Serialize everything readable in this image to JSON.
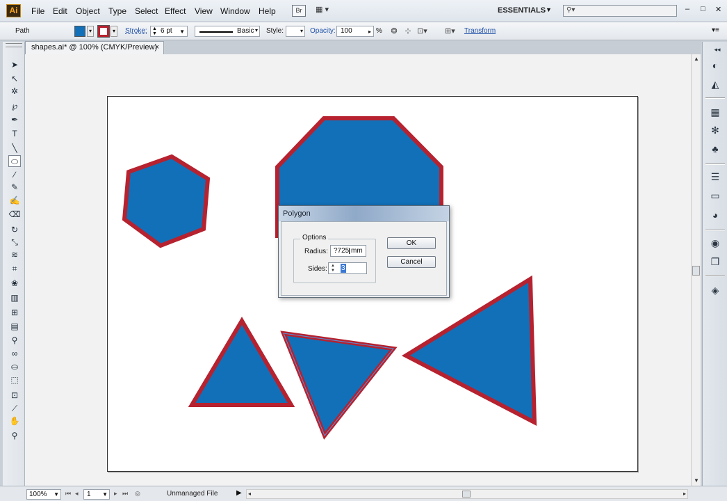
{
  "app": {
    "logo_text": "Ai",
    "menu": [
      "File",
      "Edit",
      "Object",
      "Type",
      "Select",
      "Effect",
      "View",
      "Window",
      "Help"
    ],
    "bridge_label": "Br",
    "workspace": "ESSENTIALS",
    "window_controls": {
      "minimize": "–",
      "restore": "□",
      "close": "✕"
    }
  },
  "control_bar": {
    "selection_type": "Path",
    "stroke_label": "Stroke:",
    "stroke_weight": "6 pt",
    "brush_label": "Basic",
    "style_label": "Style:",
    "opacity_label": "Opacity:",
    "opacity_value": "100",
    "opacity_unit": "%",
    "transform_label": "Transform",
    "colors": {
      "fill": "#1270b8",
      "stroke": "#b6222f"
    }
  },
  "document": {
    "tab_title": "shapes.ai* @ 100% (CMYK/Preview)",
    "tab_close": "×"
  },
  "tools": [
    {
      "name": "selection-tool-icon",
      "glyph": "➤"
    },
    {
      "name": "direct-selection-tool-icon",
      "glyph": "↖"
    },
    {
      "name": "magic-wand-tool-icon",
      "glyph": "✲"
    },
    {
      "name": "lasso-tool-icon",
      "glyph": "℘"
    },
    {
      "name": "pen-tool-icon",
      "glyph": "✒"
    },
    {
      "name": "type-tool-icon",
      "glyph": "T"
    },
    {
      "name": "line-segment-tool-icon",
      "glyph": "╲"
    },
    {
      "name": "shape-tool-icon",
      "glyph": "⬭",
      "active": true
    },
    {
      "name": "paintbrush-tool-icon",
      "glyph": "∕"
    },
    {
      "name": "pencil-tool-icon",
      "glyph": "✎"
    },
    {
      "name": "blob-brush-tool-icon",
      "glyph": "✍"
    },
    {
      "name": "eraser-tool-icon",
      "glyph": "⌫"
    },
    {
      "name": "rotate-tool-icon",
      "glyph": "↻"
    },
    {
      "name": "scale-tool-icon",
      "glyph": "⤡"
    },
    {
      "name": "warp-tool-icon",
      "glyph": "≋"
    },
    {
      "name": "free-transform-tool-icon",
      "glyph": "⌗"
    },
    {
      "name": "symbol-sprayer-tool-icon",
      "glyph": "❀"
    },
    {
      "name": "graph-tool-icon",
      "glyph": "▥"
    },
    {
      "name": "mesh-tool-icon",
      "glyph": "⊞"
    },
    {
      "name": "gradient-tool-icon",
      "glyph": "▤"
    },
    {
      "name": "eyedropper-tool-icon",
      "glyph": "⚲"
    },
    {
      "name": "blend-tool-icon",
      "glyph": "∞"
    },
    {
      "name": "live-paint-bucket-tool-icon",
      "glyph": "⛀"
    },
    {
      "name": "live-paint-selection-tool-icon",
      "glyph": "⬚"
    },
    {
      "name": "artboard-tool-icon",
      "glyph": "⊡"
    },
    {
      "name": "slice-tool-icon",
      "glyph": "⟋"
    },
    {
      "name": "hand-tool-icon",
      "glyph": "✋"
    },
    {
      "name": "zoom-tool-icon",
      "glyph": "⚲"
    }
  ],
  "dock_icons": [
    "color-panel-icon",
    "color-guide-icon",
    "swatches-icon",
    "brushes-icon",
    "symbols-icon",
    "stroke-panel-icon",
    "gradient-panel-icon",
    "transparency-panel-icon",
    "appearance-panel-icon",
    "graphic-styles-icon",
    "layers-panel-icon"
  ],
  "dock_glyphs": [
    "◐",
    "◭",
    "▦",
    "✻",
    "♣",
    "☰",
    "▭",
    "◕",
    "◉",
    "❐",
    "◈"
  ],
  "dialog": {
    "title": "Polygon",
    "group_label": "Options",
    "radius_label": "Radius:",
    "radius_value": "?725 mm",
    "sides_label": "Sides:",
    "sides_value": "3",
    "ok_label": "OK",
    "cancel_label": "Cancel"
  },
  "status_bar": {
    "zoom": "100%",
    "page": "1",
    "status_text": "Unmanaged File"
  }
}
